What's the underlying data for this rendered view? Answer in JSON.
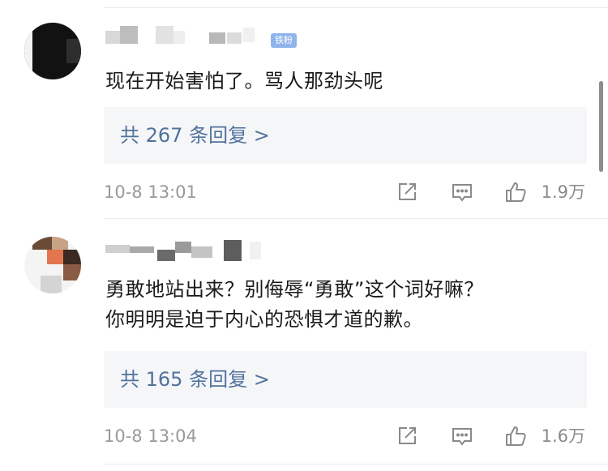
{
  "comments": [
    {
      "username": "",
      "badge": "铁粉",
      "text": "现在开始害怕了。骂人那劲头呢",
      "reply_label": "共 267 条回复 >",
      "time": "10-8 13:01",
      "likes": "1.9万"
    },
    {
      "username": "",
      "badge": "",
      "text_lines": [
        "勇敢地站出来？别侮辱“勇敢”这个词好嘛？",
        "你明明是迫于内心的恐惧才道的歉。"
      ],
      "reply_label": "共 165 条回复 >",
      "time": "10-8 13:04",
      "likes": "1.6万"
    }
  ],
  "icons": {
    "share": "share-icon",
    "comment": "comment-icon",
    "like": "thumbs-up-icon"
  },
  "colors": {
    "link_blue": "#51729d",
    "meta_gray": "#9a9a9a",
    "badge_blue": "#8fb4ec",
    "reply_bg": "#f5f6f8"
  }
}
